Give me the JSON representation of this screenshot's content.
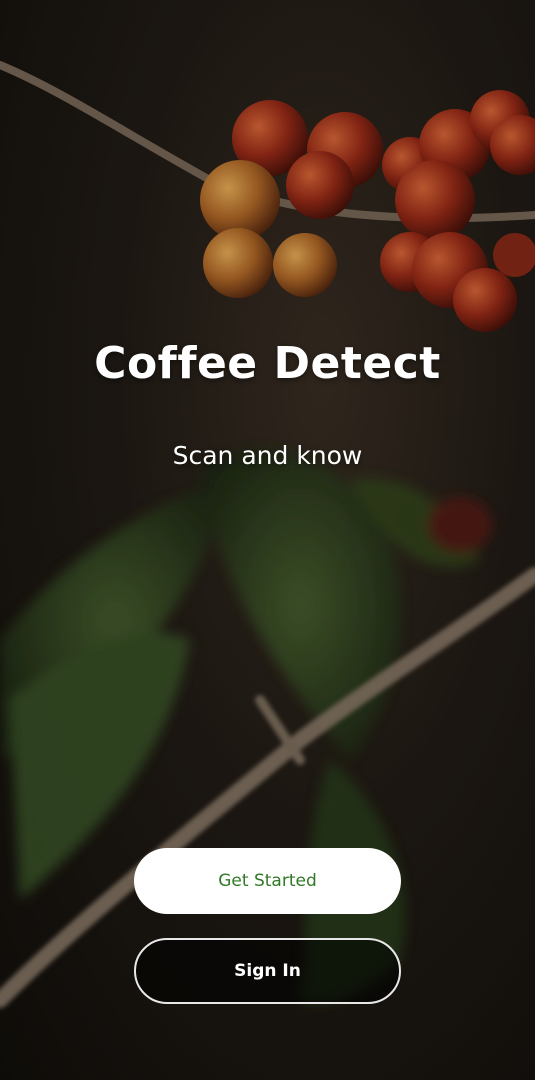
{
  "app": {
    "title": "Coffee Detect",
    "tagline": "Scan and know"
  },
  "actions": {
    "get_started_label": "Get Started",
    "sign_in_label": "Sign In"
  },
  "colors": {
    "primary_button_bg": "#ffffff",
    "primary_button_text": "#2f7a26",
    "secondary_button_border": "#e8e8e8",
    "text": "#ffffff"
  },
  "background": {
    "image_subject": "coffee-cherries-on-branch"
  }
}
